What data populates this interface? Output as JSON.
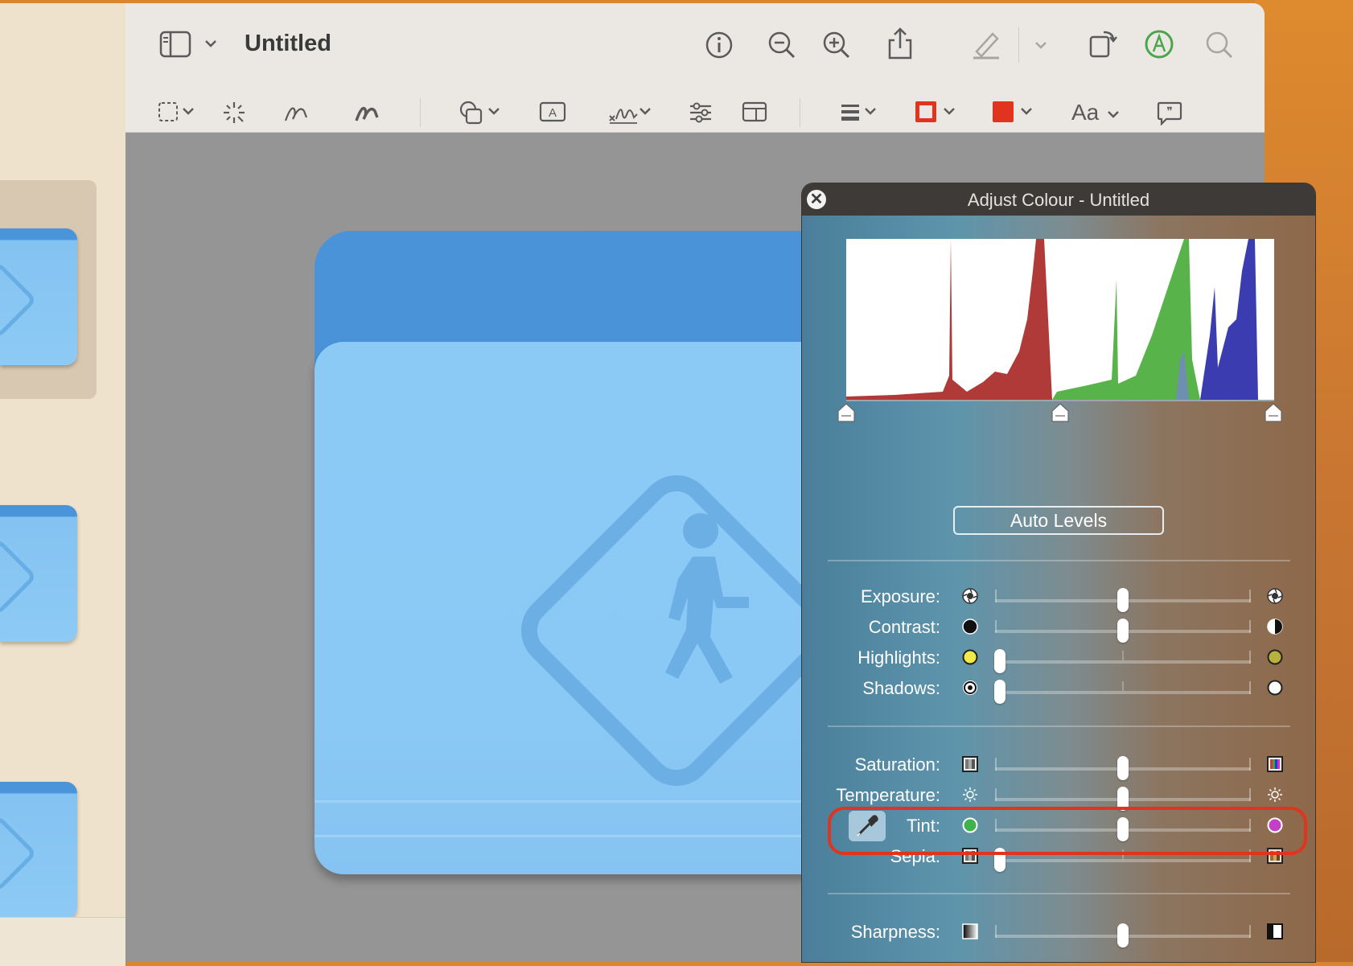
{
  "window": {
    "title": "Untitled"
  },
  "toolbar": {
    "top_icons": [
      "sidebar-toggle-icon",
      "chevron-down-icon",
      "info-icon",
      "zoom-out-icon",
      "zoom-in-icon",
      "share-icon",
      "highlight-pen-icon",
      "chevron-down-icon",
      "rotate-icon",
      "markup-icon",
      "search-icon"
    ],
    "markup_icons": [
      "rect-select-icon",
      "instant-alpha-icon",
      "sketch-icon",
      "draw-icon",
      "shapes-icon",
      "text-box-icon",
      "signature-icon",
      "adjust-colour-icon",
      "page-layout-icon",
      "line-style-icon",
      "border-colour-icon",
      "fill-colour-icon",
      "text-style-icon",
      "note-icon"
    ],
    "text_style_label": "Aa",
    "border_color": "#e0341f",
    "fill_color": "#e0341f"
  },
  "panel": {
    "title": "Adjust Colour - Untitled",
    "auto_levels_label": "Auto Levels",
    "sliders": [
      {
        "label": "Exposure:",
        "value": 0.5
      },
      {
        "label": "Contrast:",
        "value": 0.5
      },
      {
        "label": "Highlights:",
        "value": 0.02
      },
      {
        "label": "Shadows:",
        "value": 0.02
      },
      {
        "label": "Saturation:",
        "value": 0.5
      },
      {
        "label": "Temperature:",
        "value": 0.5
      },
      {
        "label": "Tint:",
        "value": 0.5
      },
      {
        "label": "Sepia:",
        "value": 0.02
      },
      {
        "label": "Sharpness:",
        "value": 0.5
      }
    ],
    "histogram_colors": {
      "red": "#b03a38",
      "green": "#58b34b",
      "blue": "#3a3cb0"
    },
    "highlight_color": "#e0341f"
  }
}
